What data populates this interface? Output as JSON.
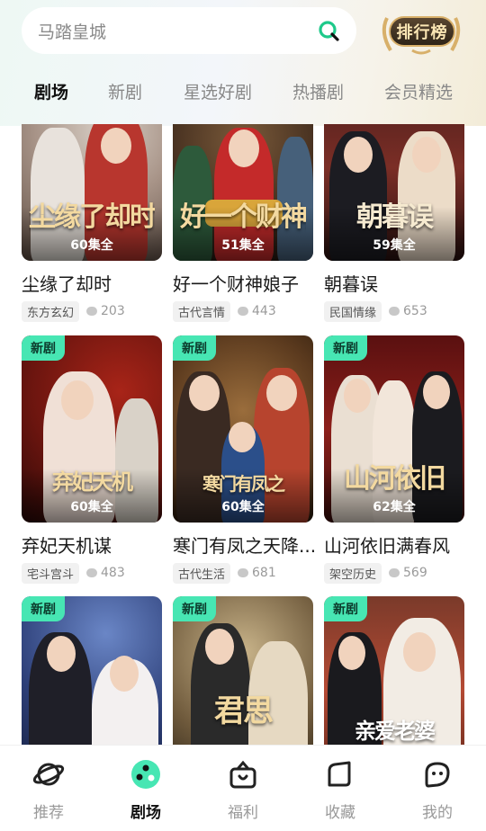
{
  "search": {
    "placeholder": "马踏皇城"
  },
  "ranking_button": "排行榜",
  "tabs": [
    "剧场",
    "新剧",
    "星选好剧",
    "热播剧",
    "会员精选"
  ],
  "new_badge": "新剧",
  "dramas": [
    {
      "poster_title": "尘缘了却时",
      "episodes": "60集全",
      "title": "尘缘了却时",
      "tag": "东方玄幻",
      "comments": "203"
    },
    {
      "poster_title": "好一个财神娘子",
      "episodes": "51集全",
      "title": "好一个财神娘子",
      "tag": "古代言情",
      "comments": "443"
    },
    {
      "poster_title": "朝暮误",
      "episodes": "59集全",
      "title": "朝暮误",
      "tag": "民国情缘",
      "comments": "653"
    },
    {
      "poster_title": "弃妃天机",
      "episodes": "60集全",
      "title": "弃妃天机谋",
      "tag": "宅斗宫斗",
      "comments": "483"
    },
    {
      "poster_title": "寒门有凤之",
      "episodes": "60集全",
      "title": "寒门有凤之天降...",
      "tag": "古代生活",
      "comments": "681"
    },
    {
      "poster_title": "山河依旧",
      "episodes": "62集全",
      "title": "山河依旧满春风",
      "tag": "架空历史",
      "comments": "569"
    },
    {
      "poster_title": "",
      "episodes": "",
      "title": "",
      "tag": "",
      "comments": ""
    },
    {
      "poster_title": "君思",
      "episodes": "",
      "title": "",
      "tag": "",
      "comments": ""
    },
    {
      "poster_title": "亲爱老婆",
      "episodes": "",
      "title": "",
      "tag": "",
      "comments": ""
    }
  ],
  "bottom_nav": [
    "推荐",
    "剧场",
    "福利",
    "收藏",
    "我的"
  ],
  "colors": {
    "accent": "#47e6b3",
    "search_icon": "#1ec98a",
    "rank_gold": "#d8b06a"
  }
}
